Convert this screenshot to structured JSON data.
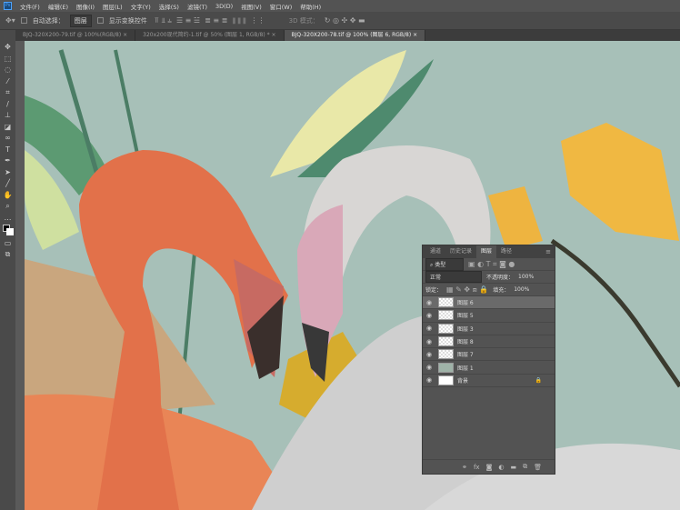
{
  "menu": [
    "文件(F)",
    "编辑(E)",
    "图像(I)",
    "图层(L)",
    "文字(Y)",
    "选择(S)",
    "滤镜(T)",
    "3D(D)",
    "视图(V)",
    "窗口(W)",
    "帮助(H)"
  ],
  "options": {
    "auto_select": "自动选择：",
    "auto_select_value": "图层",
    "show_transform": "显示变换控件",
    "mode_3d": "3D 模式："
  },
  "doc_tabs": [
    {
      "label": "BJQ-320X200-79.tif @ 100%(RGB/8)",
      "active": false
    },
    {
      "label": "320x200现代简约-1.tif @ 50% (图层 1, RGB/8) *",
      "active": false
    },
    {
      "label": "BJQ-320X200-78.tif @ 100% (图层 6, RGB/8)",
      "active": true
    }
  ],
  "layers_panel": {
    "tabs": [
      "通道",
      "历史记录",
      "图层",
      "路径"
    ],
    "active_tab": "图层",
    "filter_kind": "类型",
    "blend_mode": "正常",
    "opacity_label": "不透明度：",
    "opacity": "100%",
    "lock_label": "锁定：",
    "fill_label": "填充：",
    "fill": "100%",
    "layers": [
      {
        "name": "图层 6",
        "selected": true
      },
      {
        "name": "图层 5",
        "selected": false
      },
      {
        "name": "图层 3",
        "selected": false
      },
      {
        "name": "图层 8",
        "selected": false
      },
      {
        "name": "图层 7",
        "selected": false
      },
      {
        "name": "图层 1",
        "selected": false
      },
      {
        "name": "背景",
        "selected": false,
        "locked": true
      }
    ]
  }
}
